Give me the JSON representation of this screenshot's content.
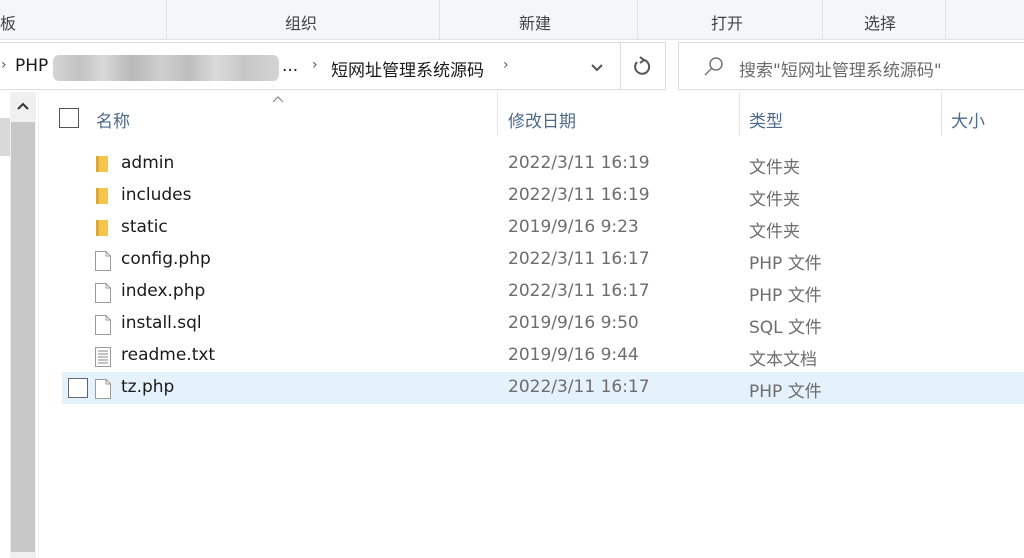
{
  "ribbon": {
    "groups": [
      {
        "label": "板"
      },
      {
        "label": "组织"
      },
      {
        "label": "新建"
      },
      {
        "label": "打开"
      },
      {
        "label": "选择"
      }
    ]
  },
  "address_bar": {
    "crumbs": [
      {
        "label": "PHP"
      },
      {
        "label": "..."
      },
      {
        "label": "短网址管理系统源码"
      }
    ],
    "dropdown_icon": "chevron-down-icon",
    "refresh_icon": "refresh-icon"
  },
  "search": {
    "placeholder": "搜索\"短网址管理系统源码\"",
    "icon": "search-icon"
  },
  "columns": {
    "name": "名称",
    "date": "修改日期",
    "type": "类型",
    "size": "大小"
  },
  "files": [
    {
      "name": "admin",
      "date": "2022/3/11 16:19",
      "type": "文件夹",
      "icon": "folder-icon"
    },
    {
      "name": "includes",
      "date": "2022/3/11 16:19",
      "type": "文件夹",
      "icon": "folder-icon"
    },
    {
      "name": "static",
      "date": "2019/9/16 9:23",
      "type": "文件夹",
      "icon": "folder-icon"
    },
    {
      "name": "config.php",
      "date": "2022/3/11 16:17",
      "type": "PHP 文件",
      "icon": "file-icon"
    },
    {
      "name": "index.php",
      "date": "2022/3/11 16:17",
      "type": "PHP 文件",
      "icon": "file-icon"
    },
    {
      "name": "install.sql",
      "date": "2019/9/16 9:50",
      "type": "SQL 文件",
      "icon": "file-icon"
    },
    {
      "name": "readme.txt",
      "date": "2019/9/16 9:44",
      "type": "文本文档",
      "icon": "text-file-icon"
    },
    {
      "name": "tz.php",
      "date": "2022/3/11 16:17",
      "type": "PHP 文件",
      "icon": "file-icon",
      "selected": true
    }
  ],
  "colors": {
    "selection": "#e5f1fb",
    "header_text": "#4d6a8a",
    "folder": "#f3c64c"
  }
}
